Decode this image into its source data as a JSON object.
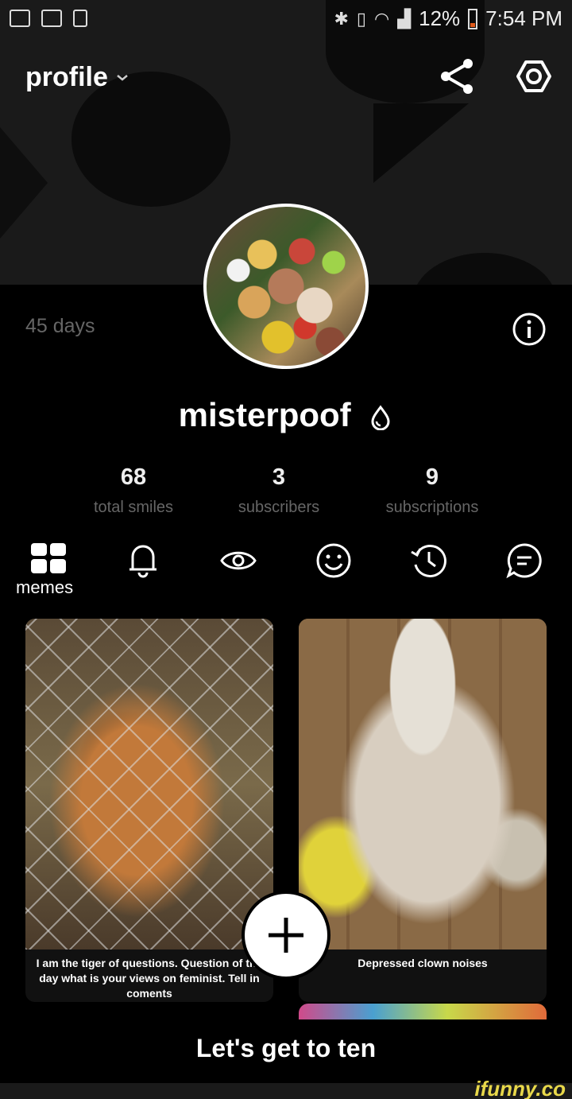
{
  "status_bar": {
    "battery": "12%",
    "time": "7:54 PM",
    "icons": [
      "voicemail-icon",
      "image-icon",
      "sim-icon",
      "bluetooth-icon",
      "vibrate-icon",
      "wifi-icon",
      "signal-icon",
      "battery-icon"
    ]
  },
  "header": {
    "title": "profile",
    "icons": [
      "chevron-down-icon",
      "share-icon",
      "settings-icon"
    ]
  },
  "profile": {
    "days": "45 days",
    "username": "misterpoof",
    "stats": [
      {
        "value": "68",
        "label": "total smiles"
      },
      {
        "value": "3",
        "label": "subscribers"
      },
      {
        "value": "9",
        "label": "subscriptions"
      }
    ]
  },
  "tabs": {
    "active_label": "memes",
    "icons": [
      "grid-icon",
      "bell-icon",
      "eye-icon",
      "smile-icon",
      "history-icon",
      "comment-icon"
    ]
  },
  "memes": [
    {
      "caption": "I am the tiger of questions. Question of the day what is your views on feminist. Tell in coments"
    },
    {
      "caption": "Depressed clown noises"
    }
  ],
  "bottom": {
    "caption": "Let's get to ten"
  },
  "watermark": "ifunny.co"
}
